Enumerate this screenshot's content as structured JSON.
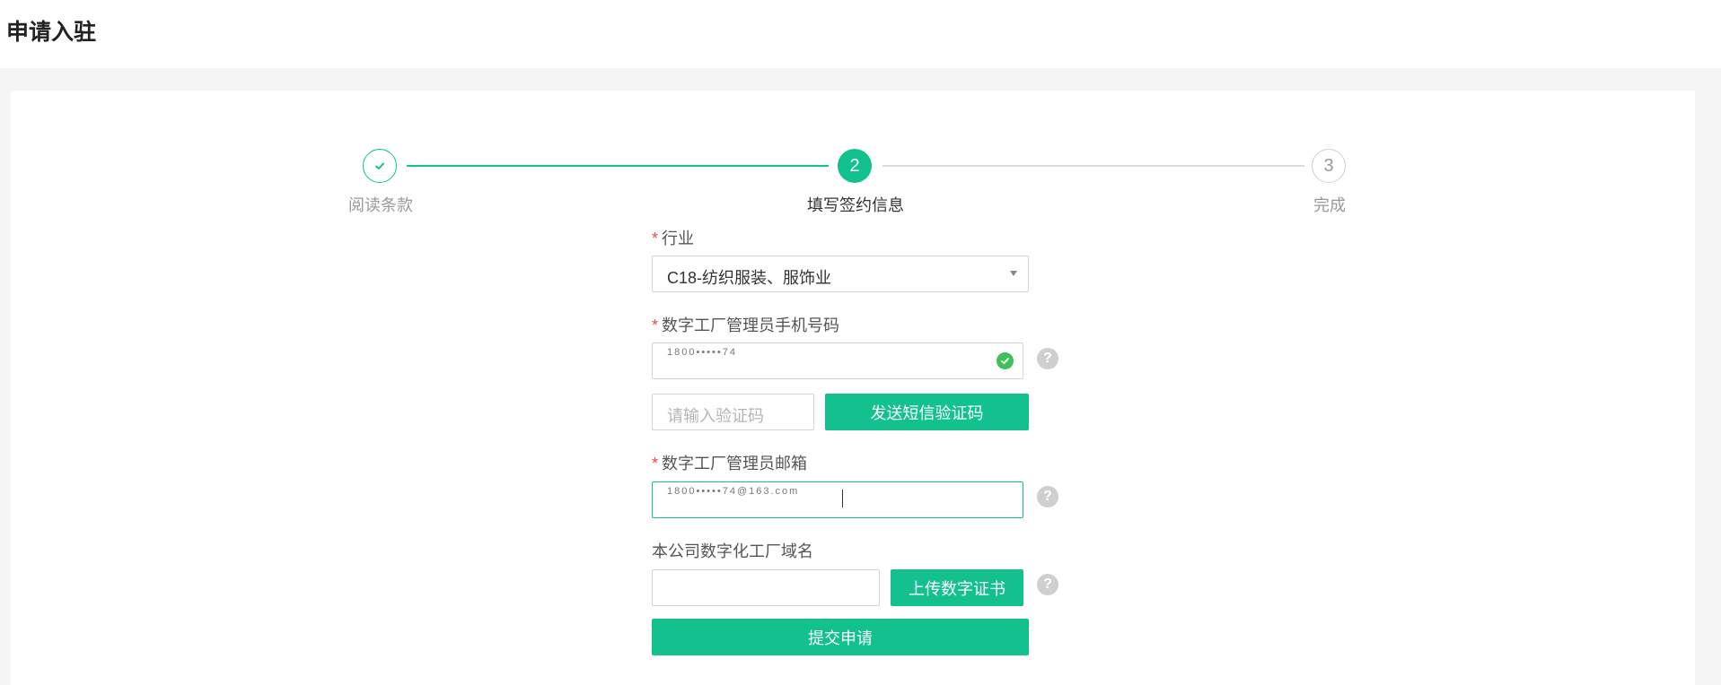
{
  "page": {
    "title": "申请入驻"
  },
  "steps": [
    {
      "number": "1",
      "label": "阅读条款",
      "status": "done"
    },
    {
      "number": "2",
      "label": "填写签约信息",
      "status": "active"
    },
    {
      "number": "3",
      "label": "完成",
      "status": "todo"
    }
  ],
  "form": {
    "required_mark": "*",
    "industry": {
      "label": "行业",
      "value": "C18-纺织服装、服饰业"
    },
    "phone": {
      "label": "数字工厂管理员手机号码",
      "value": "1800•••••74",
      "help": "?"
    },
    "verify": {
      "placeholder": "请输入验证码",
      "send_button": "发送短信验证码"
    },
    "email": {
      "label": "数字工厂管理员邮箱",
      "value": "1800•••••74@163.com",
      "help": "?"
    },
    "domain": {
      "label": "本公司数字化工厂域名",
      "value": "",
      "upload_button": "上传数字证书",
      "help": "?"
    },
    "submit_button": "提交申请"
  },
  "colors": {
    "accent": "#12c18e",
    "required": "#e84a4a",
    "success": "#3cc05a"
  }
}
